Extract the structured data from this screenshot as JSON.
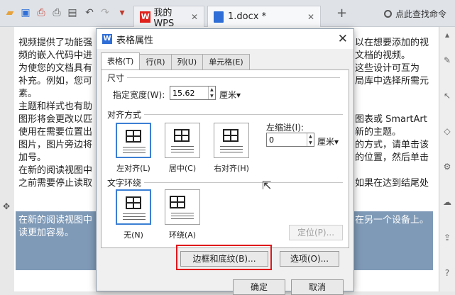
{
  "app": {
    "tabs": [
      {
        "label": "我的WPS"
      },
      {
        "label": "1.docx *"
      }
    ],
    "find_label": "点此查找命令"
  },
  "document": {
    "lines": [
      "视频提供了功能强",
      "频的嵌入代码中进",
      "为使您的文档具有",
      "补充。例如，您可",
      "素。",
      "主题和样式也有助",
      "图形将会更改以匹",
      "使用在需要位置出",
      "图片，图片旁边将",
      "加号。",
      "在新的阅读视图中",
      "之前需要停止读取"
    ],
    "lines_right": [
      "以在想要添加的视",
      "文档的视频。",
      "这些设计可互为",
      "局库中选择所需元",
      "",
      "",
      "图表或 SmartArt",
      "新的主题。",
      "的方式，请单击该",
      "的位置，然后单击",
      "",
      "如果在达到结尾处"
    ],
    "selected_lines": [
      "在新的阅读视图中",
      "读更加容易。"
    ],
    "selected_right": "在另一个设备上。"
  },
  "dialog": {
    "title": "表格属性",
    "tabs": [
      "表格(T)",
      "行(R)",
      "列(U)",
      "单元格(E)"
    ],
    "size_section": "尺寸",
    "width_label": "指定宽度(W):",
    "width_value": "15.62",
    "width_unit": "厘米▾",
    "align_section": "对齐方式",
    "align_options": [
      "左对齐(L)",
      "居中(C)",
      "右对齐(H)"
    ],
    "indent_label": "左缩进(I):",
    "indent_value": "0",
    "indent_unit": "厘米▾",
    "wrap_section": "文字环绕",
    "wrap_options": [
      "无(N)",
      "环绕(A)"
    ],
    "position_button": "定位(P)...",
    "borders_button": "边框和底纹(B)...",
    "options_button": "选项(O)...",
    "ok_button": "确定",
    "cancel_button": "取消"
  }
}
